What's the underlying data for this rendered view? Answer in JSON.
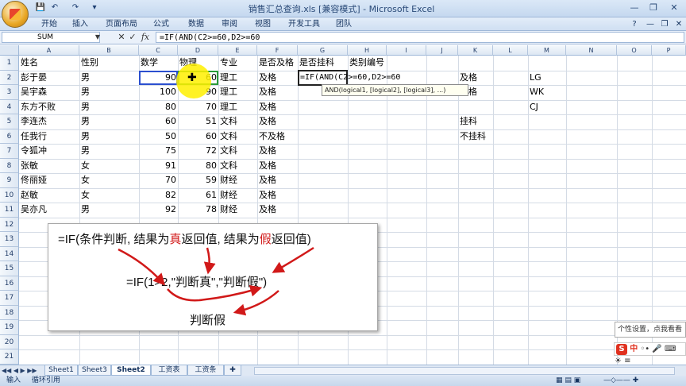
{
  "window": {
    "title": "销售汇总查询.xls [兼容模式] - Microsoft Excel"
  },
  "ribbon": {
    "tabs": [
      "开始",
      "插入",
      "页面布局",
      "公式",
      "数据",
      "审阅",
      "视图",
      "开发工具",
      "团队"
    ]
  },
  "formula_bar": {
    "name_box": "SUM",
    "fx_label": "fx",
    "formula": "=IF(AND(C2>=60,D2>=60"
  },
  "columns": [
    "A",
    "B",
    "C",
    "D",
    "E",
    "F",
    "G",
    "H",
    "I",
    "J",
    "K",
    "L",
    "M",
    "N",
    "O",
    "P"
  ],
  "rows": [
    "1",
    "2",
    "3",
    "4",
    "5",
    "6",
    "7",
    "8",
    "9",
    "10",
    "11",
    "12",
    "13",
    "14",
    "15",
    "16",
    "17",
    "18",
    "19",
    "20",
    "21"
  ],
  "table": {
    "headers": [
      "姓名",
      "性别",
      "数学",
      "物理",
      "专业",
      "是否及格",
      "是否挂科",
      "类别编号"
    ],
    "records": [
      {
        "name": "彭于晏",
        "gender": "男",
        "math": "90",
        "physics": "60",
        "major": "理工",
        "pass": "及格"
      },
      {
        "name": "吴宇森",
        "gender": "男",
        "math": "100",
        "physics": "90",
        "major": "理工",
        "pass": "及格"
      },
      {
        "name": "东方不败",
        "gender": "男",
        "math": "80",
        "physics": "70",
        "major": "理工",
        "pass": "及格"
      },
      {
        "name": "李连杰",
        "gender": "男",
        "math": "60",
        "physics": "51",
        "major": "文科",
        "pass": "及格"
      },
      {
        "name": "任我行",
        "gender": "男",
        "math": "50",
        "physics": "60",
        "major": "文科",
        "pass": "不及格"
      },
      {
        "name": "令狐冲",
        "gender": "男",
        "math": "75",
        "physics": "72",
        "major": "文科",
        "pass": "及格"
      },
      {
        "name": "张敏",
        "gender": "女",
        "math": "91",
        "physics": "80",
        "major": "文科",
        "pass": "及格"
      },
      {
        "name": "佟丽娅",
        "gender": "女",
        "math": "70",
        "physics": "59",
        "major": "财经",
        "pass": "及格"
      },
      {
        "name": "赵敏",
        "gender": "女",
        "math": "82",
        "physics": "61",
        "major": "财经",
        "pass": "及格"
      },
      {
        "name": "吴亦凡",
        "gender": "男",
        "math": "92",
        "physics": "78",
        "major": "财经",
        "pass": "及格"
      }
    ],
    "editing_cell_text": "=IF(AND(C2>=60,D2>=60",
    "side_values": {
      "k2": "及格",
      "k3": "及格",
      "k5": "挂科",
      "k6": "不挂科",
      "m2": "LG",
      "m3": "WK",
      "m4": "CJ"
    }
  },
  "tooltip": {
    "text": "AND(logical1, [logical2], [logical3], ...)"
  },
  "explanation": {
    "line1_prefix": "=IF(条件判断, 结果为",
    "line1_true": "真",
    "line1_mid": "返回值, 结果为",
    "line1_false": "假",
    "line1_suffix": "返回值)",
    "line2": "=IF(1>2,\"判断真\",\"判断假\")",
    "result": "判断假",
    "arrow_color": "#d11919"
  },
  "sheet_tabs": [
    "Sheet1",
    "Sheet3",
    "Sheet2",
    "工资表",
    "工资条"
  ],
  "active_sheet": "Sheet2",
  "status": {
    "mode": "输入",
    "circular_ref": "循环引用"
  },
  "notify": {
    "text": "个性设置，点我看看"
  },
  "ime": {
    "lang": "中"
  }
}
